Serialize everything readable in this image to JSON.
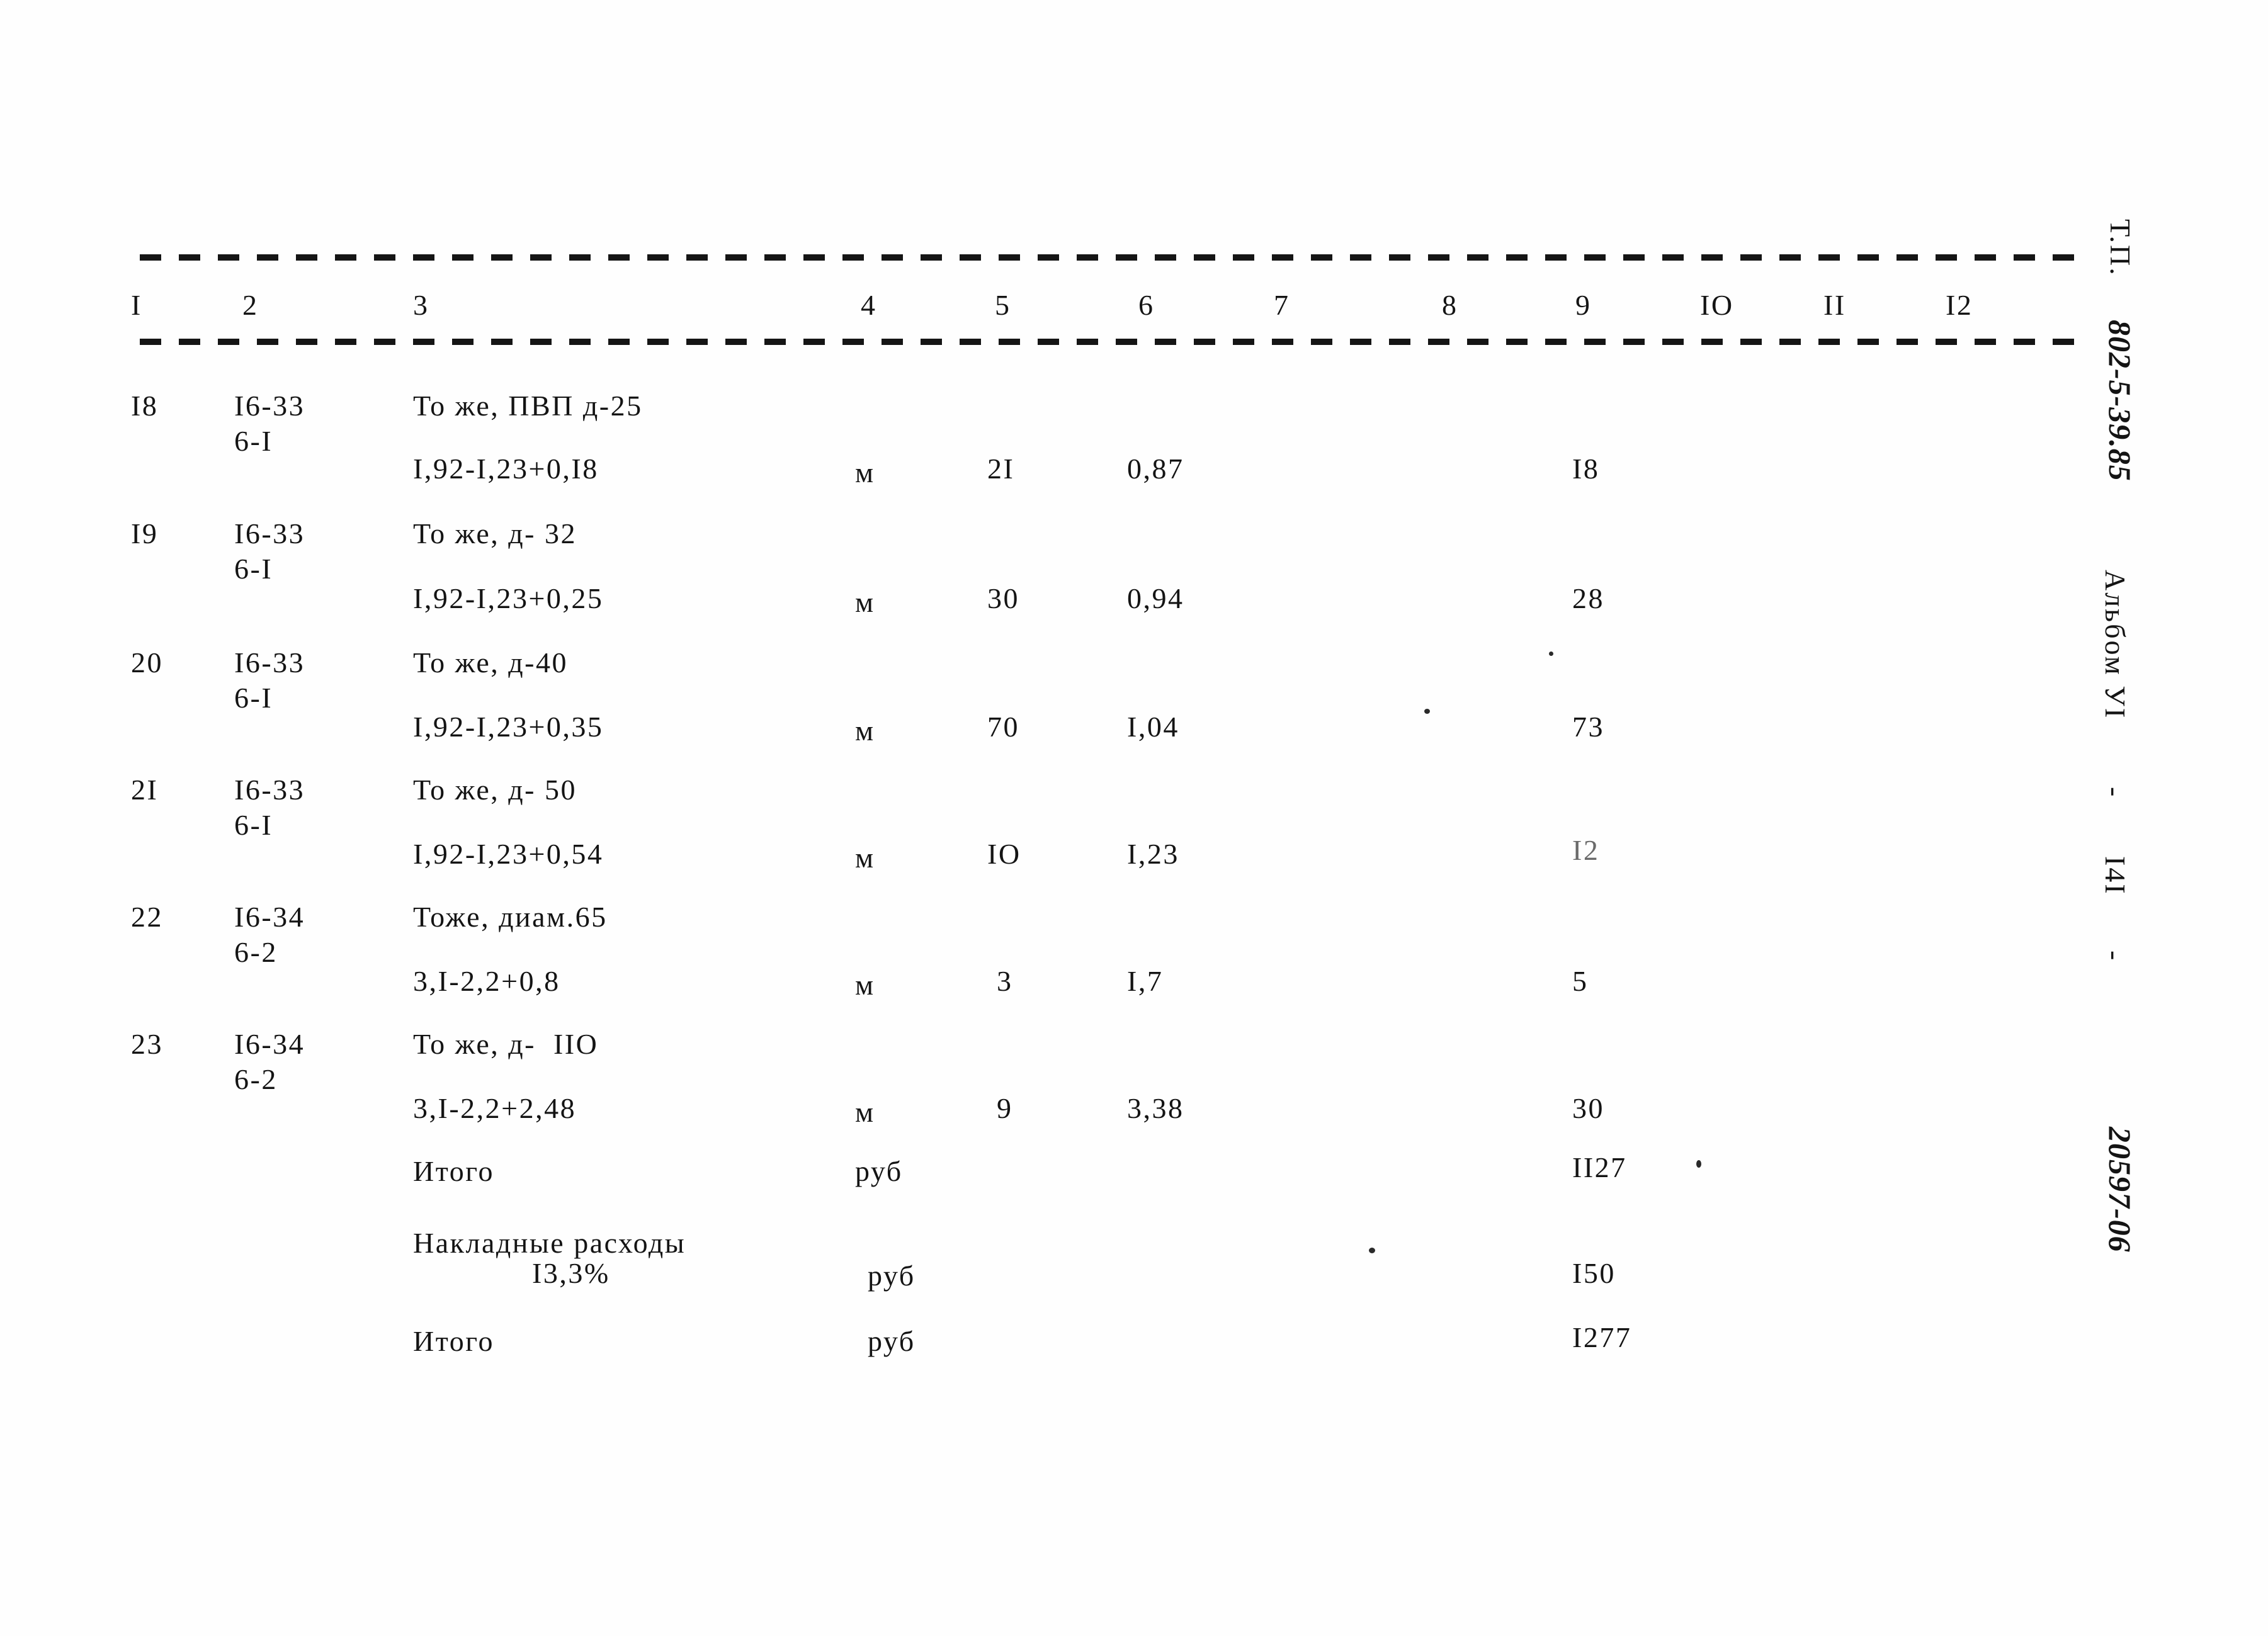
{
  "document": {
    "kind": "scanned-estimate-table",
    "background_color": "#fefefe",
    "ink_color": "#141414"
  },
  "table": {
    "column_headers": [
      "I",
      "2",
      "3",
      "4",
      "5",
      "6",
      "7",
      "8",
      "9",
      "IO",
      "II",
      "I2"
    ],
    "rows": [
      {
        "num": "I8",
        "code_top": "I6-33",
        "code_bottom": "6-I",
        "desc_top": "То же, ПВП д-25",
        "desc_bottom": "I,92-I,23+0,I8",
        "unit": "м",
        "qty": "2I",
        "price": "0,87",
        "total": "I8"
      },
      {
        "num": "I9",
        "code_top": "I6-33",
        "code_bottom": "6-I",
        "desc_top": "То же, д- 32",
        "desc_bottom": "I,92-I,23+0,25",
        "unit": "м",
        "qty": "30",
        "price": "0,94",
        "total": "28"
      },
      {
        "num": "20",
        "code_top": "I6-33",
        "code_bottom": "6-I",
        "desc_top": "То же, д-40",
        "desc_bottom": "I,92-I,23+0,35",
        "unit": "м",
        "qty": "70",
        "price": "I,04",
        "total": "73"
      },
      {
        "num": "2I",
        "code_top": "I6-33",
        "code_bottom": "6-I",
        "desc_top": "То же, д- 50",
        "desc_bottom": "I,92-I,23+0,54",
        "unit": "м",
        "qty": "IO",
        "price": "I,23",
        "total": "I2"
      },
      {
        "num": "22",
        "code_top": "I6-34",
        "code_bottom": "6-2",
        "desc_top": "Тоже, диам.65",
        "desc_bottom": "3,I-2,2+0,8",
        "unit": "м",
        "qty": "3",
        "price": "I,7",
        "total": "5"
      },
      {
        "num": "23",
        "code_top": "I6-34",
        "code_bottom": "6-2",
        "desc_top": "То же, д-  IIO",
        "desc_bottom": "3,I-2,2+2,48",
        "unit": "м",
        "qty": "9",
        "price": "3,38",
        "total": "30"
      }
    ],
    "summary": [
      {
        "label": "Итого",
        "label2": "",
        "unit": "руб",
        "total": "II27"
      },
      {
        "label": "Накладные расходы",
        "label2": "I3,3%",
        "unit": "руб",
        "total": "I50"
      },
      {
        "label": "Итого",
        "label2": "",
        "unit": "руб",
        "total": "I277"
      }
    ]
  },
  "margin": {
    "series_prefix": "Т.П.",
    "series_number": "802-5-39.85",
    "album": "Альбом УI",
    "dash1": "-",
    "page": "I4I",
    "dash2": "-",
    "doc_number": "20597-06"
  }
}
